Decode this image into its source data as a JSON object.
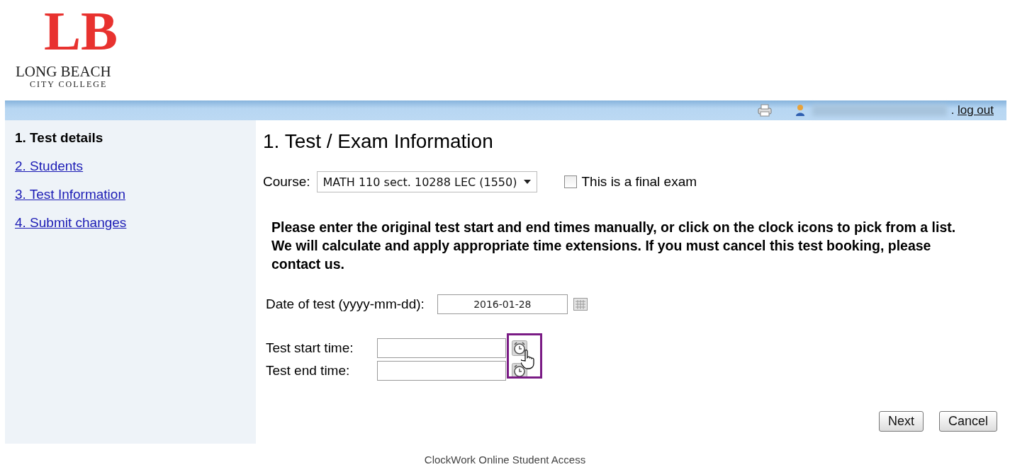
{
  "logo": {
    "monogram": "LB",
    "name": "LONG BEACH",
    "subtitle": "CITY COLLEGE"
  },
  "header_bar": {
    "logout_prefix": ".",
    "logout": "log out"
  },
  "sidebar": {
    "items": [
      {
        "label": "1. Test details",
        "selected": true
      },
      {
        "label": "2. Students",
        "selected": false
      },
      {
        "label": "3. Test Information",
        "selected": false
      },
      {
        "label": "4. Submit changes",
        "selected": false
      }
    ]
  },
  "main": {
    "title": "1. Test / Exam Information",
    "course": {
      "label": "Course:",
      "value": "MATH 110 sect. 10288 LEC (1550)"
    },
    "final_exam": {
      "label": "This is a final exam",
      "checked": false
    },
    "instructions": "Please enter the original test start and end times manually, or click on the clock icons to pick from a list. We will calculate and apply appropriate time extensions. If you must cancel this test booking, please contact us.",
    "date": {
      "label": "Date of test (yyyy-mm-dd):",
      "value": "2016-01-28"
    },
    "times": [
      {
        "label": "Test start time:"
      },
      {
        "label": "Test end time:"
      }
    ],
    "buttons": [
      "Next",
      "Cancel"
    ]
  },
  "footer": "ClockWork Online Student Access"
}
